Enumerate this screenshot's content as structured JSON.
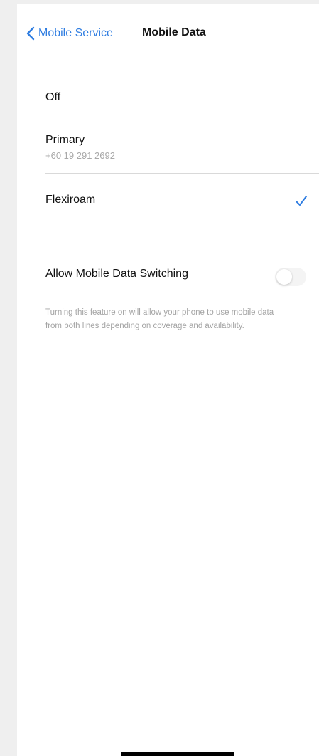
{
  "nav": {
    "back_label": "Mobile Service",
    "back_icon": "chevron-left-icon",
    "title": "Mobile Data"
  },
  "options": [
    {
      "label": "Off",
      "subtitle": ""
    },
    {
      "label": "Primary",
      "subtitle": "+60 19 291 2692"
    },
    {
      "label": "Flexiroam",
      "subtitle": "",
      "selected": true
    }
  ],
  "switch": {
    "label": "Allow Mobile Data Switching",
    "enabled": false,
    "footnote": "Turning this feature on will allow your phone to use mobile data from both lines depending on coverage and availability."
  },
  "colors": {
    "accent": "#2f7de1",
    "background": "#ffffff",
    "secondary_text": "#a9a9a9"
  }
}
